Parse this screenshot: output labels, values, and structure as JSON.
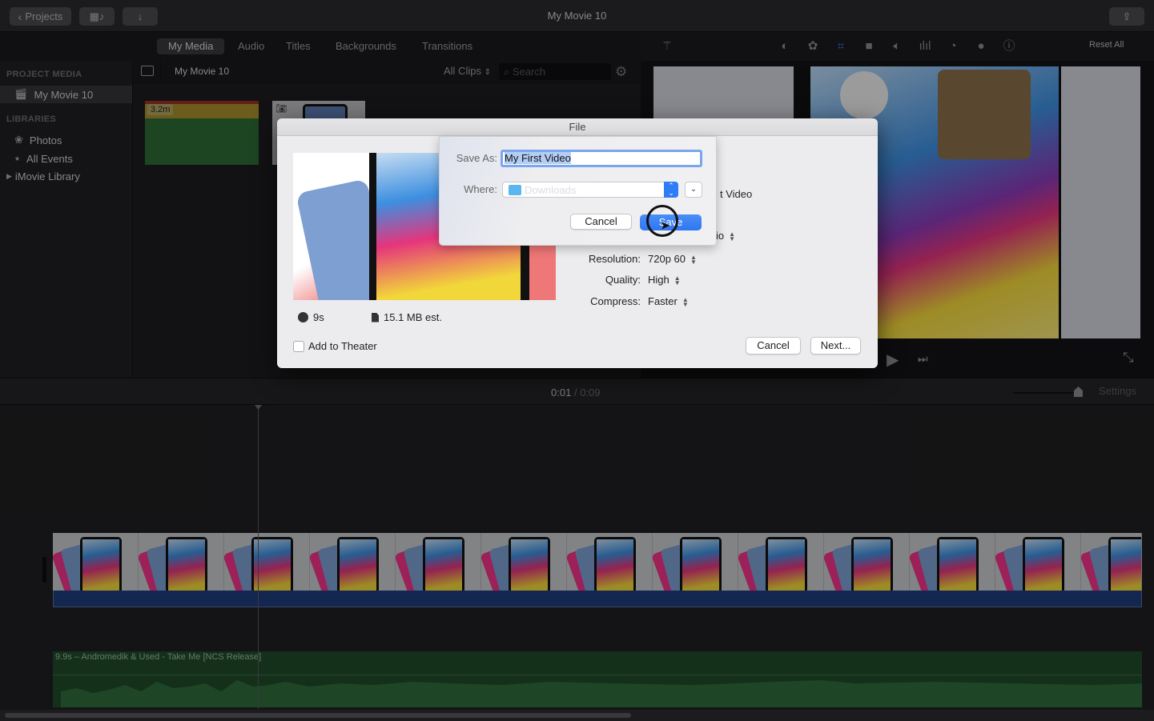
{
  "window": {
    "title": "My Movie 10"
  },
  "titlebar": {
    "projects_label": "Projects",
    "media_toggle_icon": "film-music-icon",
    "import_icon": "download-arrow-icon",
    "share_icon": "share-icon"
  },
  "browser_tabs": [
    {
      "label": "My Media",
      "active": true
    },
    {
      "label": "Audio",
      "active": false
    },
    {
      "label": "Titles",
      "active": false
    },
    {
      "label": "Backgrounds",
      "active": false
    },
    {
      "label": "Transitions",
      "active": false
    }
  ],
  "sidebar": {
    "project_media_header": "PROJECT MEDIA",
    "project_item": "My Movie 10",
    "libraries_header": "LIBRARIES",
    "items": [
      {
        "label": "Photos",
        "icon": "photos-flower-icon"
      },
      {
        "label": "All Events",
        "icon": "star-events-icon"
      },
      {
        "label": "iMovie Library",
        "icon": "disclosure-triangle-icon"
      }
    ]
  },
  "browser": {
    "title": "My Movie 10",
    "filter": "All Clips",
    "search_placeholder": "Search",
    "clips": [
      {
        "duration": "3.2m",
        "type": "audio"
      },
      {
        "duration": "",
        "type": "photo"
      }
    ]
  },
  "viewer_tools": {
    "icons": [
      "magic-wand-icon",
      "color-balance-icon",
      "color-palette-icon",
      "crop-icon",
      "stabilization-icon",
      "volume-icon",
      "equalizer-icon",
      "speed-icon",
      "clip-filter-icon",
      "info-icon"
    ],
    "reset_all": "Reset All"
  },
  "timeline_bar": {
    "current_time": "0:01",
    "separator": "/",
    "total_time": "0:09",
    "settings_label": "Settings",
    "zoom_level": 0.9
  },
  "timeline": {
    "audio_clip_label": "9.9s – Andromedik & Used - Take Me [NCS Release]",
    "video_frames": 13
  },
  "share_dialog": {
    "title": "File",
    "partial_title_text": "t Video",
    "partial_format_text": "io",
    "settings": [
      {
        "label": "Resolution:",
        "value": "720p 60"
      },
      {
        "label": "Quality:",
        "value": "High"
      },
      {
        "label": "Compress:",
        "value": "Faster"
      }
    ],
    "duration": "9s",
    "file_size": "15.1 MB est.",
    "add_to_theater_label": "Add to Theater",
    "add_to_theater_checked": false,
    "cancel_label": "Cancel",
    "next_label": "Next..."
  },
  "save_sheet": {
    "save_as_label": "Save As:",
    "save_as_value": "My First Video",
    "where_label": "Where:",
    "where_value": "Downloads",
    "cancel_label": "Cancel",
    "save_label": "Save"
  },
  "colors": {
    "accent_blue": "#2f76f1",
    "audio_green": "#1f5a2c",
    "video_track_blue": "#1e3c7c"
  }
}
